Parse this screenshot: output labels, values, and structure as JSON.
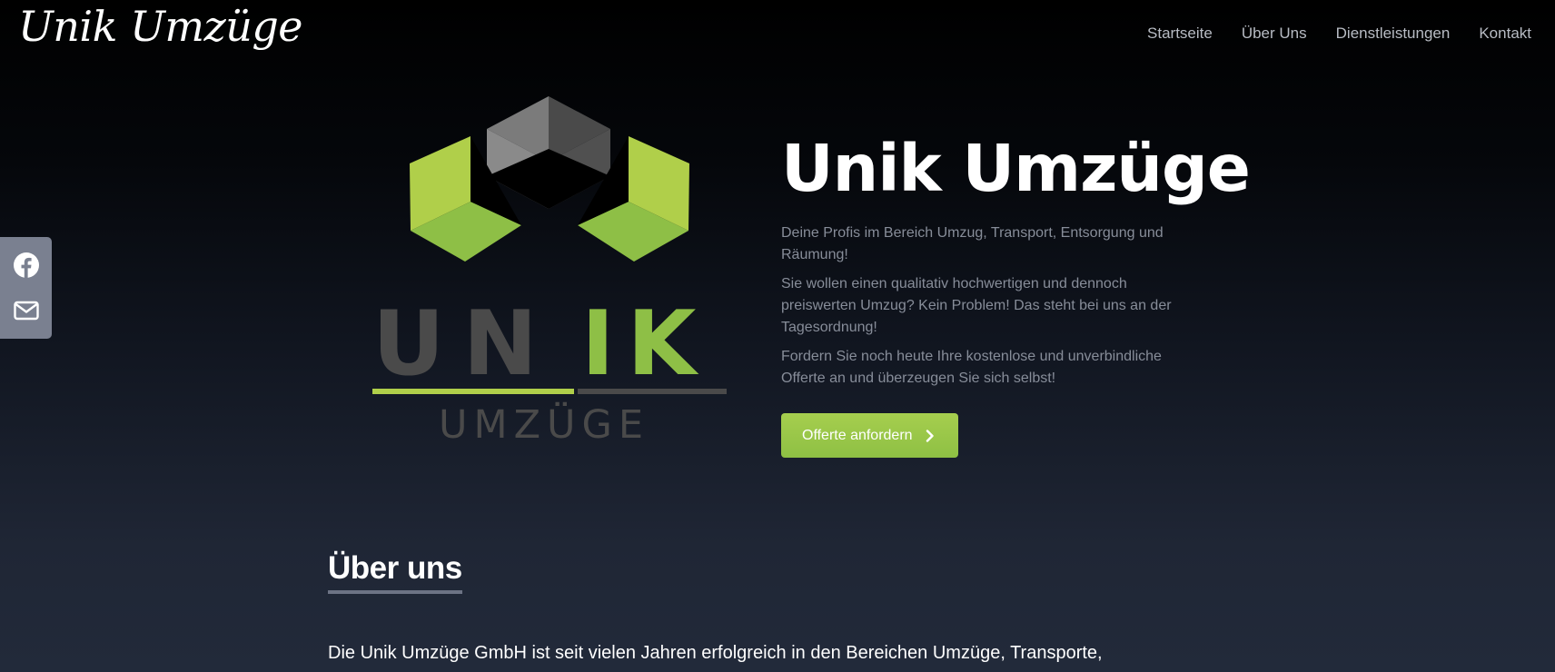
{
  "header": {
    "brand": "Unik Umzüge",
    "nav": [
      {
        "label": "Startseite"
      },
      {
        "label": "Über Uns"
      },
      {
        "label": "Dienstleistungen"
      },
      {
        "label": "Kontakt"
      }
    ]
  },
  "social": {
    "items": [
      {
        "icon": "facebook-icon"
      },
      {
        "icon": "mail-icon"
      }
    ]
  },
  "logo": {
    "word": "UNIK",
    "sub": "UMZÜGE"
  },
  "hero": {
    "title": "Unik Umzüge",
    "paragraphs": [
      "Deine Profis im Bereich Umzug, Transport, Entsorgung und Räumung!",
      "Sie wollen einen qualitativ hochwertigen und dennoch preiswerten Umzug? Kein Problem! Das steht bei uns an der Tagesordnung!",
      "Fordern Sie noch heute Ihre kostenlose und unverbindliche Offerte an und überzeugen Sie sich selbst!"
    ],
    "cta_label": "Offerte anfordern"
  },
  "about": {
    "title": "Über uns",
    "text": "Die Unik Umzüge GmbH ist seit vielen Jahren erfolgreich in den Bereichen Umzüge, Transporte,"
  },
  "colors": {
    "accent_green": "#a6ce4e",
    "logo_gray": "#4a4a4a"
  }
}
